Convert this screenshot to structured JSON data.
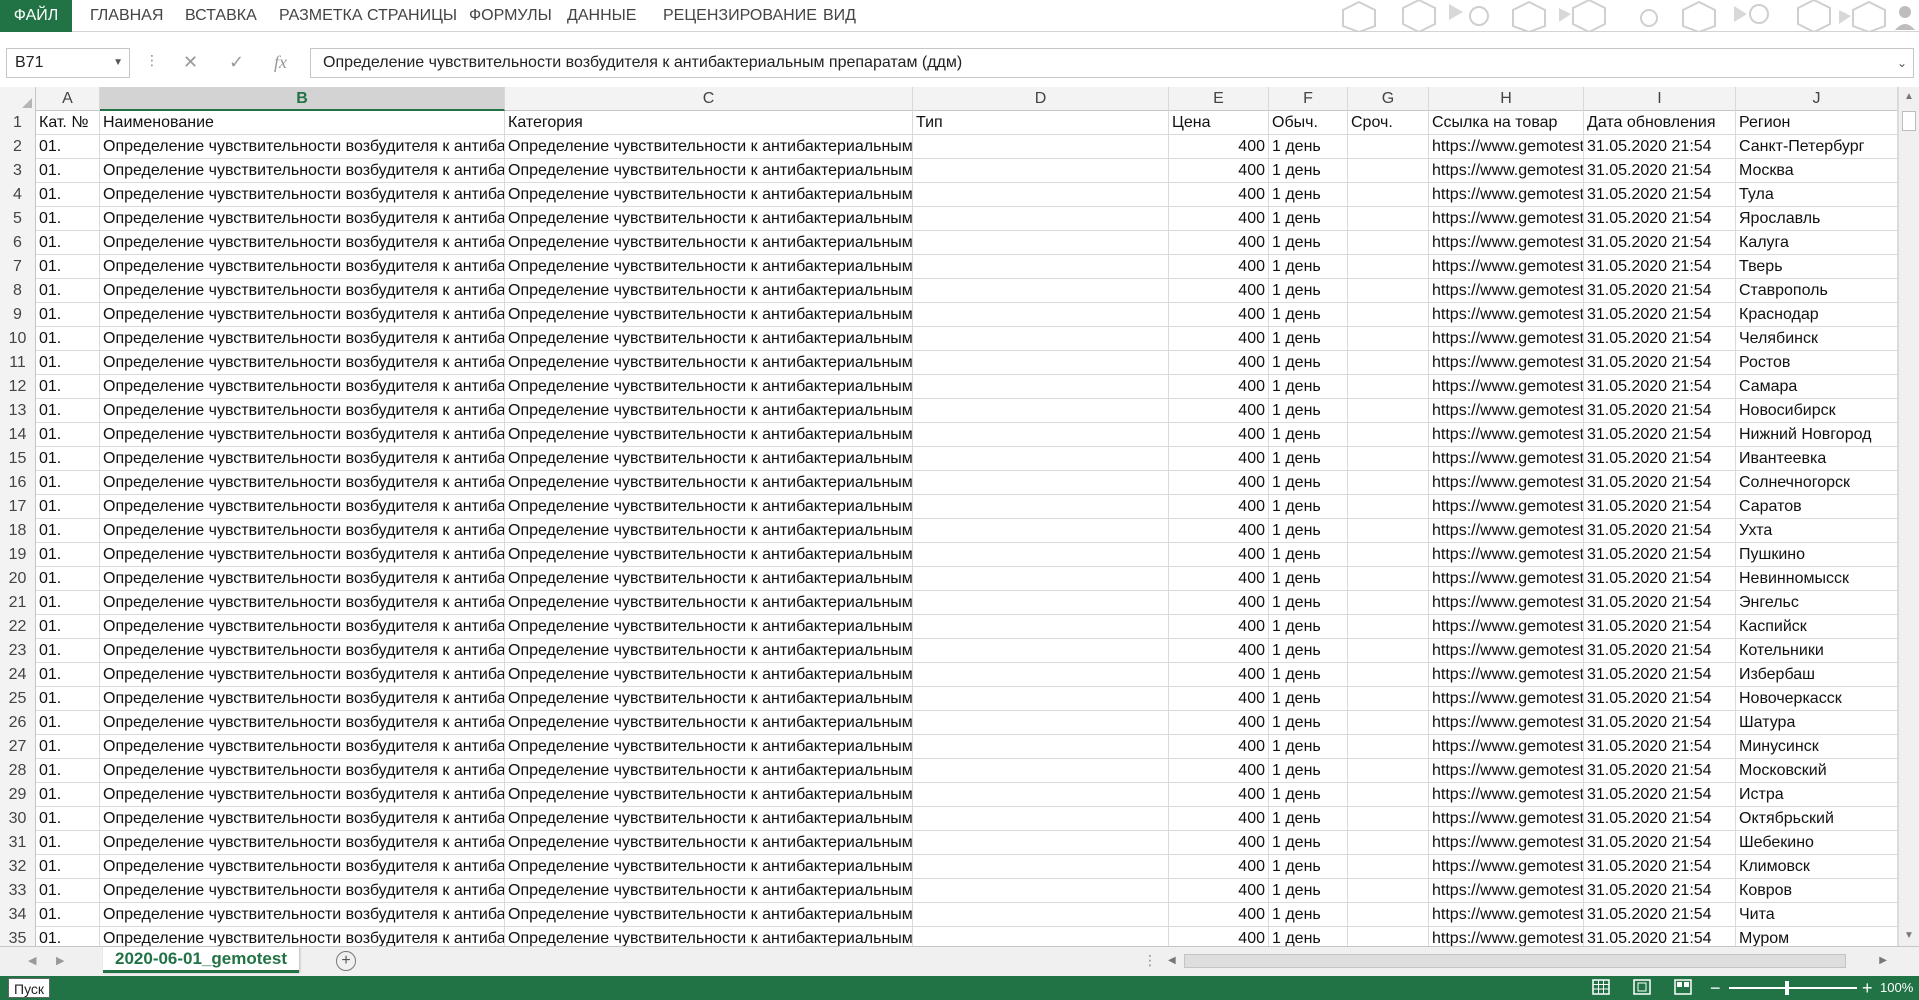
{
  "ribbon": {
    "tabs": [
      "ФАЙЛ",
      "ГЛАВНАЯ",
      "ВСТАВКА",
      "РАЗМЕТКА СТРАНИЦЫ",
      "ФОРМУЛЫ",
      "ДАННЫЕ",
      "РЕЦЕНЗИРОВАНИЕ",
      "ВИД"
    ]
  },
  "formula_bar": {
    "name_box": "B71",
    "formula": "Определение чувствительности возбудителя к антибактериальным препаратам (ддм)",
    "fx_label": "fx"
  },
  "grid": {
    "selected_column": "B",
    "columns": [
      "A",
      "B",
      "C",
      "D",
      "E",
      "F",
      "G",
      "H",
      "I",
      "J"
    ],
    "header_row": [
      "Кат. №",
      "Наименование",
      "Категория",
      "Тип",
      "Цена",
      "Обыч.",
      "Сроч.",
      "Ссылка на товар",
      "Дата обновления",
      "Регион"
    ],
    "row_template": {
      "cat": "01.",
      "name": "Определение чувствительности возбудителя к антибактериальным препаратам (ддм)",
      "category": "Определение чувствительности к антибактериальным препаратам, антимикотикам и",
      "type": "",
      "price": "400",
      "regular": "1 день",
      "urgent": "",
      "link": "https://www.gemotest.ru",
      "date": "31.05.2020 21:54"
    },
    "regions": [
      "Санкт-Петербург",
      "Москва",
      "Тула",
      "Ярославль",
      "Калуга",
      "Тверь",
      "Ставрополь",
      "Краснодар",
      "Челябинск",
      "Ростов",
      "Самара",
      "Новосибирск",
      "Нижний Новгород",
      "Ивантеевка",
      "Солнечногорск",
      "Саратов",
      "Ухта",
      "Пушкино",
      "Невинномысск",
      "Энгельс",
      "Каспийск",
      "Котельники",
      "Избербаш",
      "Новочеркасск",
      "Шатура",
      "Минусинск",
      "Московский",
      "Истра",
      "Октябрьский",
      "Шебекино",
      "Климовск",
      "Ковров",
      "Чита",
      "Муром"
    ]
  },
  "sheet_tabs": {
    "active": "2020-06-01_gemotest",
    "add_symbol": "+"
  },
  "status_bar": {
    "start_label": "Пуск",
    "zoom_minus": "−",
    "zoom_plus": "+",
    "zoom": "100%"
  },
  "colors": {
    "accent": "#217346"
  }
}
